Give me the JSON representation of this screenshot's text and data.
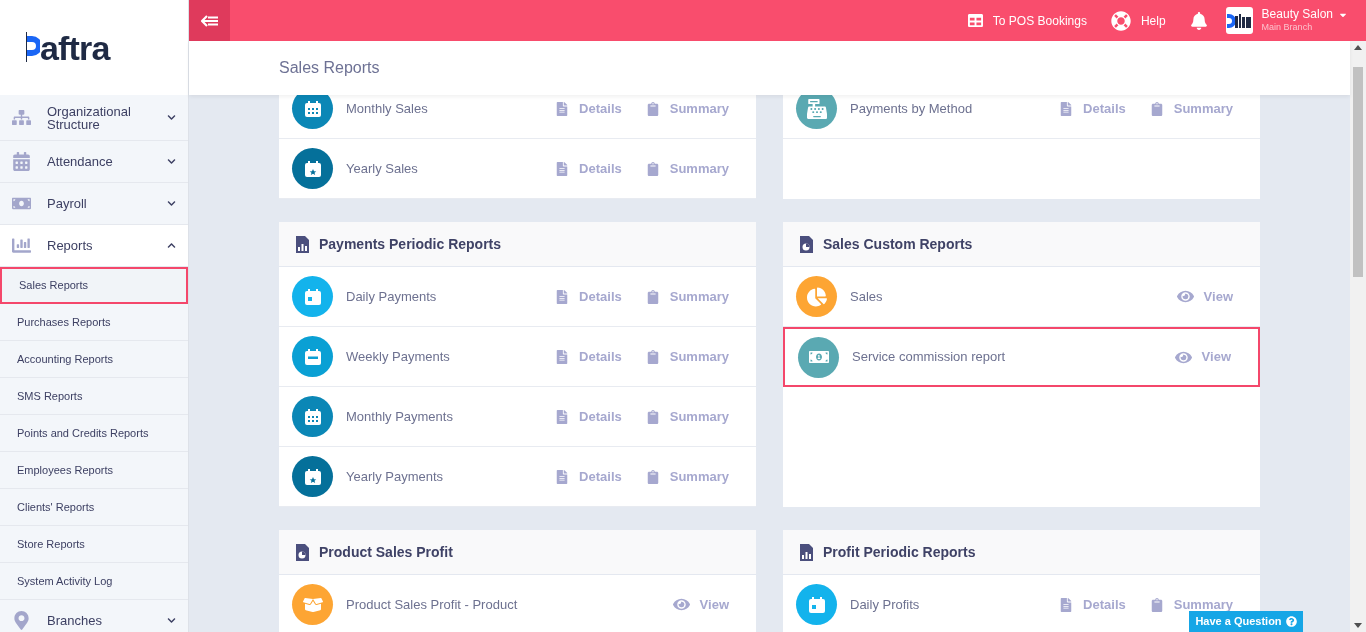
{
  "logo": {
    "text": "aftra"
  },
  "top_bar": {
    "links": [
      {
        "label": "To POS Bookings",
        "kind": "pos"
      },
      {
        "label": "Help",
        "kind": "help"
      }
    ],
    "account": {
      "name": "Beauty Salon",
      "branch": "Main Branch"
    }
  },
  "sidebar": {
    "items": [
      {
        "label": "Organizational Structure",
        "kind": "sitemap",
        "expanded": false
      },
      {
        "label": "Attendance",
        "kind": "calendar",
        "expanded": false
      },
      {
        "label": "Payroll",
        "kind": "money",
        "expanded": false
      },
      {
        "label": "Reports",
        "kind": "chart",
        "expanded": true,
        "children": [
          {
            "label": "Sales Reports",
            "selected": true
          },
          {
            "label": "Purchases Reports",
            "selected": false
          },
          {
            "label": "Accounting Reports",
            "selected": false
          },
          {
            "label": "SMS Reports",
            "selected": false
          },
          {
            "label": "Points and Credits Reports",
            "selected": false
          },
          {
            "label": "Employees Reports",
            "selected": false
          },
          {
            "label": "Clients' Reports",
            "selected": false
          },
          {
            "label": "Store Reports",
            "selected": false
          },
          {
            "label": "System Activity Log",
            "selected": false
          }
        ]
      },
      {
        "label": "Branches",
        "kind": "pin",
        "expanded": false
      }
    ]
  },
  "page_title": "Sales Reports",
  "sections": [
    {
      "rows": [
        {
          "label": "Monthly Sales",
          "kind": "calendar-month",
          "color": "#0b87b6",
          "highlighted": false,
          "actions": [
            {
              "label": "Details",
              "kind": "details"
            },
            {
              "label": "Summary",
              "kind": "summary"
            }
          ]
        },
        {
          "label": "Yearly Sales",
          "kind": "calendar-star",
          "color": "#05709a",
          "highlighted": false,
          "actions": [
            {
              "label": "Details",
              "kind": "details"
            },
            {
              "label": "Summary",
              "kind": "summary"
            }
          ]
        }
      ]
    },
    {
      "rows": [
        {
          "label": "Payments by Method",
          "kind": "cash-register",
          "color": "#5aa9b2",
          "highlighted": false,
          "actions": [
            {
              "label": "Details",
              "kind": "details"
            },
            {
              "label": "Summary",
              "kind": "summary"
            }
          ]
        }
      ]
    },
    {
      "title": "Payments Periodic Reports",
      "kind": "bars",
      "rows": [
        {
          "label": "Daily Payments",
          "kind": "calendar-day",
          "color": "#13b3ec",
          "highlighted": false,
          "actions": [
            {
              "label": "Details",
              "kind": "details"
            },
            {
              "label": "Summary",
              "kind": "summary"
            }
          ]
        },
        {
          "label": "Weekly Payments",
          "kind": "calendar-week",
          "color": "#0aa0d4",
          "highlighted": false,
          "actions": [
            {
              "label": "Details",
              "kind": "details"
            },
            {
              "label": "Summary",
              "kind": "summary"
            }
          ]
        },
        {
          "label": "Monthly Payments",
          "kind": "calendar-month",
          "color": "#0b87b6",
          "highlighted": false,
          "actions": [
            {
              "label": "Details",
              "kind": "details"
            },
            {
              "label": "Summary",
              "kind": "summary"
            }
          ]
        },
        {
          "label": "Yearly Payments",
          "kind": "calendar-star",
          "color": "#05709a",
          "highlighted": false,
          "actions": [
            {
              "label": "Details",
              "kind": "details"
            },
            {
              "label": "Summary",
              "kind": "summary"
            }
          ]
        }
      ]
    },
    {
      "title": "Sales Custom Reports",
      "kind": "pie",
      "rows": [
        {
          "label": "Sales",
          "kind": "pie",
          "color": "#fda533",
          "highlighted": false,
          "actions": [
            {
              "label": "View",
              "kind": "view"
            }
          ]
        },
        {
          "label": "Service commission report",
          "kind": "money",
          "color": "#5aa9b2",
          "highlighted": true,
          "actions": [
            {
              "label": "View",
              "kind": "view"
            }
          ]
        }
      ]
    },
    {
      "title": "Product Sales Profit",
      "kind": "pie",
      "rows": [
        {
          "label": "Product Sales Profit - Product",
          "kind": "box",
          "color": "#fda533",
          "highlighted": false,
          "actions": [
            {
              "label": "View",
              "kind": "view"
            }
          ]
        }
      ]
    },
    {
      "title": "Profit Periodic Reports",
      "kind": "bars",
      "rows": [
        {
          "label": "Daily Profits",
          "kind": "calendar-day",
          "color": "#13b3ec",
          "highlighted": false,
          "actions": [
            {
              "label": "Details",
              "kind": "details"
            },
            {
              "label": "Summary",
              "kind": "summary"
            }
          ]
        }
      ]
    }
  ],
  "help_button": {
    "label": "Have a Question"
  }
}
